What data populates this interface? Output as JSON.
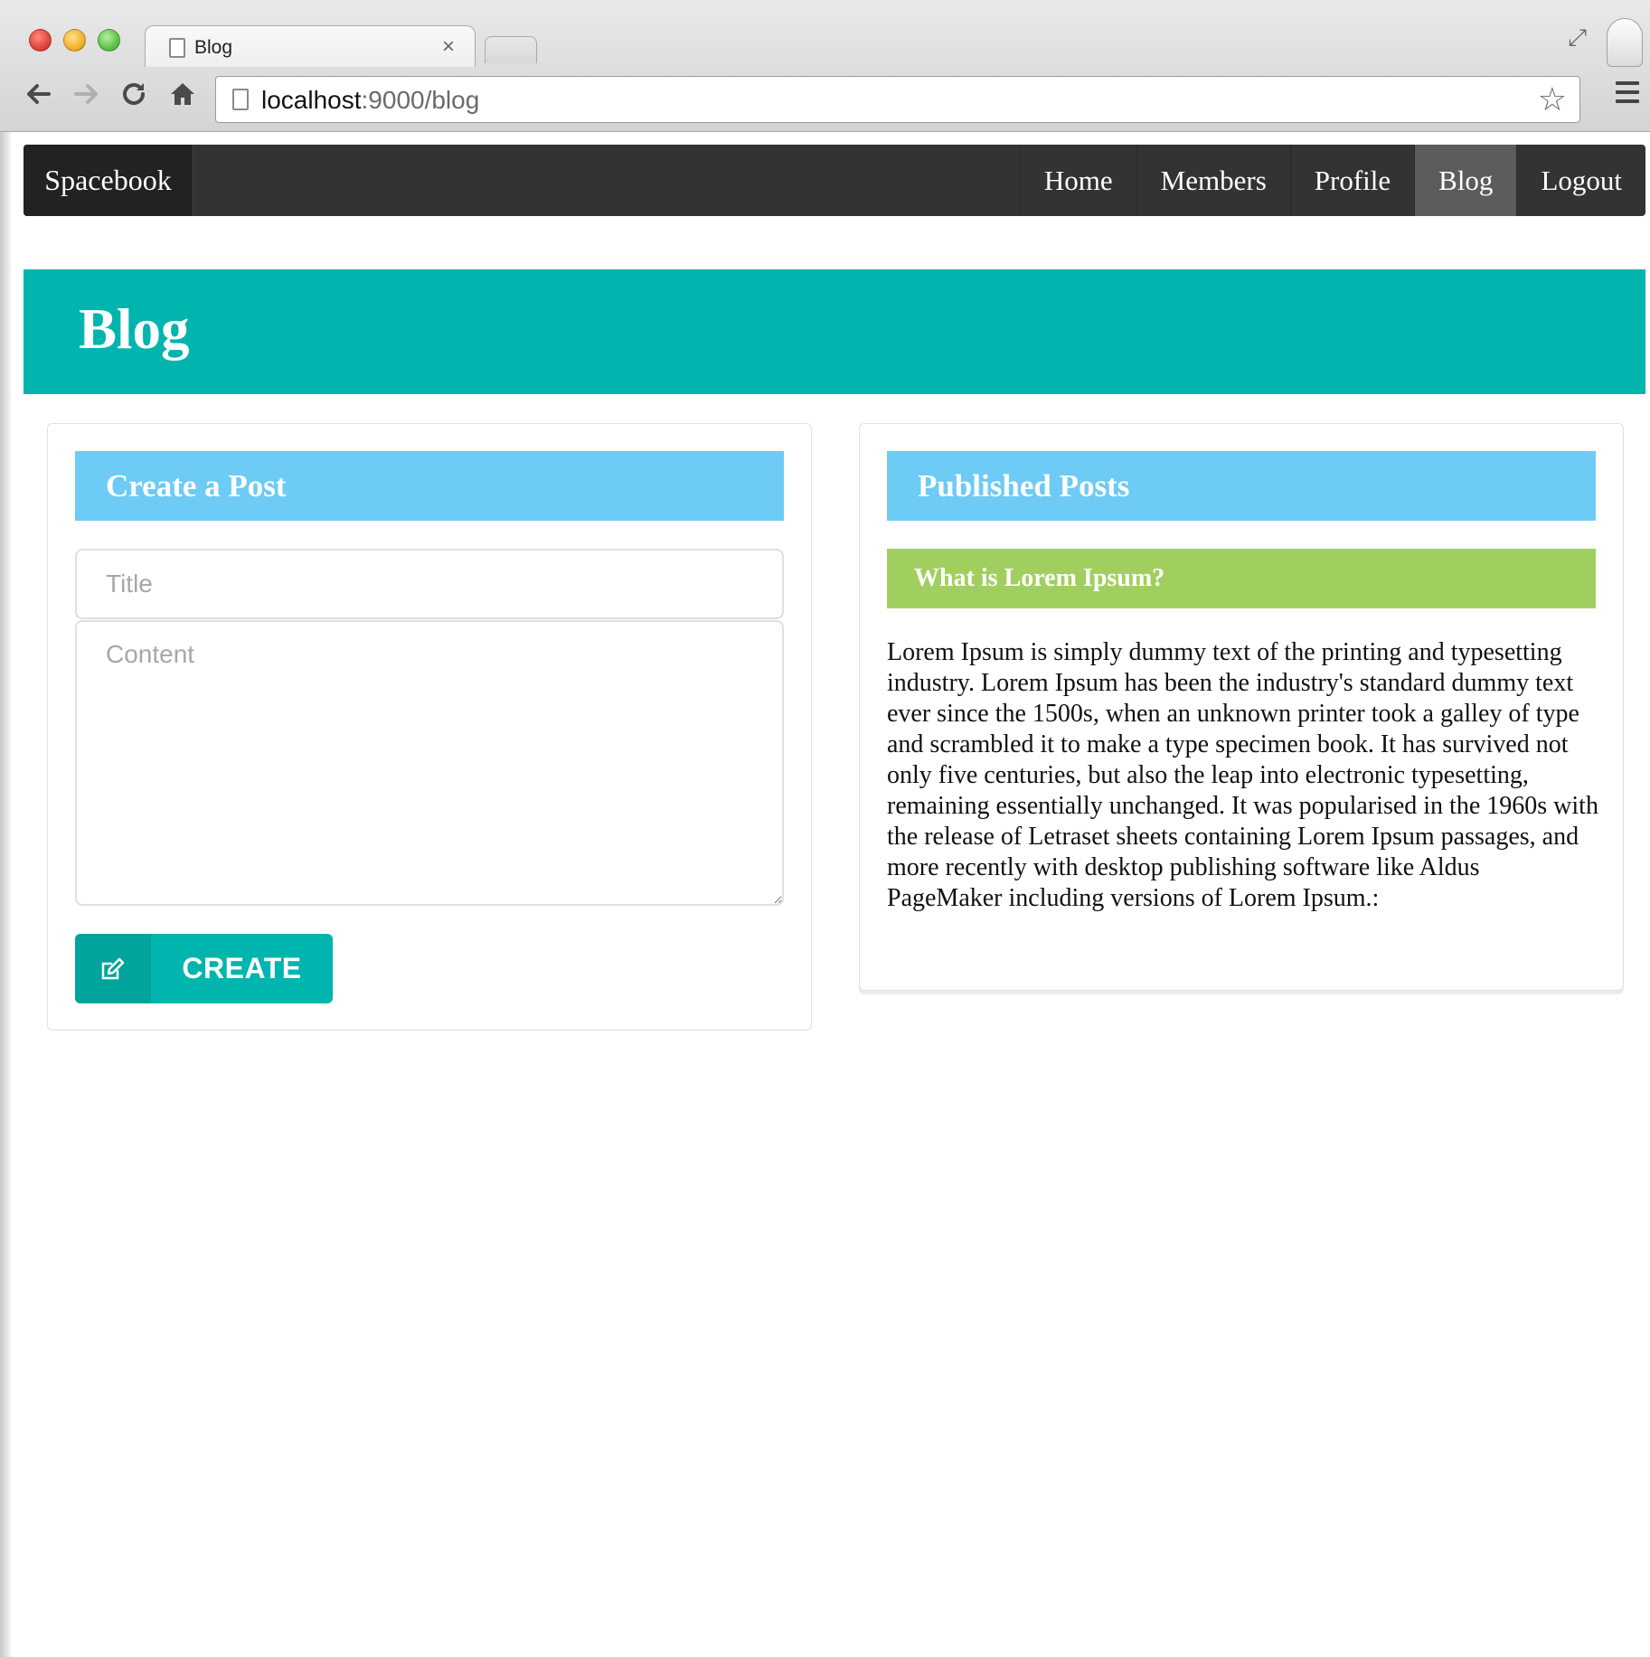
{
  "browser": {
    "tab_title": "Blog",
    "tab_close": "×",
    "url_host": "localhost",
    "url_rest": ":9000/blog"
  },
  "navbar": {
    "brand": "Spacebook",
    "items": [
      {
        "label": "Home"
      },
      {
        "label": "Members"
      },
      {
        "label": "Profile"
      },
      {
        "label": "Blog"
      },
      {
        "label": "Logout"
      }
    ],
    "active_item": "Blog"
  },
  "header": {
    "title": "Blog"
  },
  "create_post": {
    "heading": "Create a Post",
    "title_placeholder": "Title",
    "content_placeholder": "Content",
    "button_label": "CREATE"
  },
  "published_posts": {
    "heading": "Published Posts",
    "posts": [
      {
        "title": "What is Lorem Ipsum?",
        "body": "Lorem Ipsum is simply dummy text of the printing and typesetting industry. Lorem Ipsum has been the industry's standard dummy text ever since the 1500s, when an unknown printer took a galley of type and scrambled it to make a type specimen book. It has survived not only five centuries, but also the leap into electronic typesetting, remaining essentially unchanged. It was popularised in the 1960s with the release of Letraset sheets containing Lorem Ipsum passages, and more recently with desktop publishing software like Aldus PageMaker including versions of Lorem Ipsum.:"
      }
    ]
  },
  "colors": {
    "navbar": "#333333",
    "brand_bg": "#222222",
    "active_nav": "#5c5c5c",
    "header_teal": "#00b5ad",
    "section_blue": "#6dcbf5",
    "post_green": "#a1cf5f"
  },
  "icons": {
    "back": "back-arrow-icon",
    "forward": "forward-arrow-icon",
    "reload": "reload-icon",
    "home": "home-icon",
    "bookmark": "star-icon",
    "menu": "hamburger-menu-icon",
    "create": "edit-icon"
  }
}
